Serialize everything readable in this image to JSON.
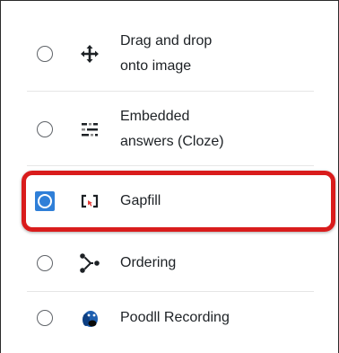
{
  "question_types": {
    "items": [
      {
        "label": "Drag and drop\nonto image",
        "icon": "move-arrows-icon",
        "selected": false
      },
      {
        "label": "Embedded\nanswers (Cloze)",
        "icon": "cloze-icon",
        "selected": false
      },
      {
        "label": "Gapfill",
        "icon": "gapfill-icon",
        "selected": true
      },
      {
        "label": "Ordering",
        "icon": "ordering-icon",
        "selected": false
      },
      {
        "label": "Poodll Recording",
        "icon": "poodll-icon",
        "selected": false
      }
    ]
  },
  "colors": {
    "selected_radio": "#2f7fd8",
    "highlight_border": "#d91c1c"
  }
}
